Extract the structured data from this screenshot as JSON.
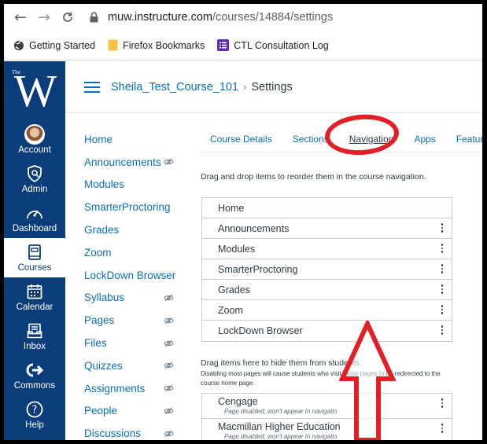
{
  "browser": {
    "url_host": "muw.instructure.com",
    "url_path": "/courses/14884/settings",
    "bookmarks": [
      {
        "label": "Getting Started",
        "icon": "globe-icon"
      },
      {
        "label": "Firefox Bookmarks",
        "icon": "folder-icon"
      },
      {
        "label": "CTL Consultation Log",
        "icon": "list-icon"
      }
    ]
  },
  "global_nav": {
    "logo_the": "The",
    "logo_letter": "W",
    "items": [
      {
        "label": "Account",
        "icon": "avatar-icon",
        "active": false
      },
      {
        "label": "Admin",
        "icon": "shield-icon",
        "active": false
      },
      {
        "label": "Dashboard",
        "icon": "speedometer-icon",
        "active": false
      },
      {
        "label": "Courses",
        "icon": "book-icon",
        "active": true
      },
      {
        "label": "Calendar",
        "icon": "calendar-icon",
        "active": false
      },
      {
        "label": "Inbox",
        "icon": "inbox-icon",
        "active": false
      },
      {
        "label": "Commons",
        "icon": "commons-icon",
        "active": false
      },
      {
        "label": "Help",
        "icon": "help-icon",
        "active": false
      }
    ]
  },
  "header": {
    "course": "Sheila_Test_Course_101",
    "separator": "›",
    "current": "Settings"
  },
  "course_nav": [
    {
      "label": "Home",
      "hidden": false
    },
    {
      "label": "Announcements",
      "hidden": true
    },
    {
      "label": "Modules",
      "hidden": false
    },
    {
      "label": "SmarterProctoring",
      "hidden": false
    },
    {
      "label": "Grades",
      "hidden": false
    },
    {
      "label": "Zoom",
      "hidden": false
    },
    {
      "label": "LockDown Browser",
      "hidden": false
    },
    {
      "label": "Syllabus",
      "hidden": true
    },
    {
      "label": "Pages",
      "hidden": true
    },
    {
      "label": "Files",
      "hidden": true
    },
    {
      "label": "Quizzes",
      "hidden": true
    },
    {
      "label": "Assignments",
      "hidden": true
    },
    {
      "label": "People",
      "hidden": true
    },
    {
      "label": "Discussions",
      "hidden": true
    }
  ],
  "tabs": [
    {
      "label": "Course Details",
      "active": false
    },
    {
      "label": "Sections",
      "active": false
    },
    {
      "label": "Navigation",
      "active": true
    },
    {
      "label": "Apps",
      "active": false
    },
    {
      "label": "Feature Op",
      "active": false
    }
  ],
  "navigation": {
    "instructions": "Drag and drop items to reorder them in the course navigation.",
    "enabled_items": [
      "Home",
      "Announcements",
      "Modules",
      "SmarterProctoring",
      "Grades",
      "Zoom",
      "LockDown Browser"
    ],
    "hide_title": "Drag items here to hide them from students.",
    "hide_note": "Disabling most pages will cause students who visit those pages to be redirected to the course home page.",
    "disabled_items": [
      {
        "name": "Cengage",
        "note": "Page disabled, won't appear in navigatio"
      },
      {
        "name": "Macmillan Higher Education",
        "note": "Page disabled, won't appear in navigatio"
      }
    ]
  },
  "colors": {
    "nav_bg": "#0b3d7a",
    "link": "#0b6fb8",
    "annotation": "#e31e26"
  }
}
